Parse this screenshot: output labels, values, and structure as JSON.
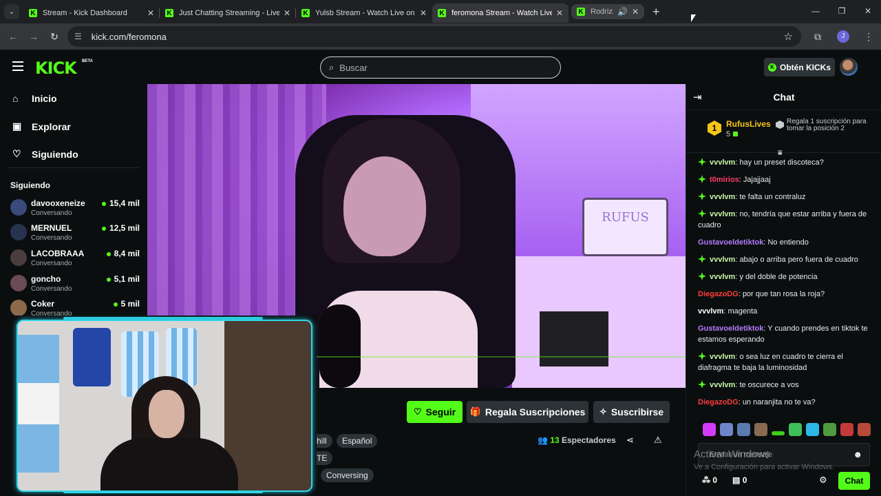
{
  "browser": {
    "tabs": [
      {
        "title": "Stream - Kick Dashboard"
      },
      {
        "title": "Just Chatting Streaming - Live S"
      },
      {
        "title": "Yulsb Stream - Watch Live on Ki"
      },
      {
        "title": "feromona Stream - Watch Live o"
      },
      {
        "title": "Rodrizz"
      }
    ],
    "url": "kick.com/feromona",
    "profile_initial": "J"
  },
  "header": {
    "logo": "KICK",
    "beta": "BETA",
    "search_placeholder": "Buscar",
    "get_kicks": "Obtén KICKs"
  },
  "sidebar": {
    "nav": [
      {
        "label": "Inicio",
        "icon": "home-icon"
      },
      {
        "label": "Explorar",
        "icon": "explore-icon"
      },
      {
        "label": "Siguiendo",
        "icon": "heart-icon"
      }
    ],
    "following_title": "Siguiendo",
    "following": [
      {
        "name": "davooxeneize",
        "category": "Conversando",
        "viewers": "15,4 mil"
      },
      {
        "name": "MERNUEL",
        "category": "Conversando",
        "viewers": "12,5 mil"
      },
      {
        "name": "LACOBRAAA",
        "category": "Conversando",
        "viewers": "8,4 mil"
      },
      {
        "name": "goncho",
        "category": "Conversando",
        "viewers": "5,1 mil"
      },
      {
        "name": "Coker",
        "category": "Conversando",
        "viewers": "5 mil"
      }
    ]
  },
  "stream": {
    "sign_text": "RUFUS",
    "follow_label": "Seguir",
    "gift_label": "Regala Suscripciones",
    "subscribe_label": "Suscribirse",
    "tags": [
      "hill",
      "Español",
      "TE",
      "Conversing"
    ],
    "viewers_count": "13",
    "viewers_label": "Espectadores"
  },
  "chat": {
    "title": "Chat",
    "pinned": {
      "rank": "1",
      "name": "RufusLives",
      "count": "5",
      "text": "Regala 1 suscripción para tomar la posición 2"
    },
    "messages": [
      {
        "user": "vvvlvm",
        "text": "hay un preset discoteca?",
        "badge": true,
        "color": "#c9f7a8"
      },
      {
        "user": "t0mirios",
        "text": "Jajajjaaj",
        "badge": true,
        "color": "#ff3b6b"
      },
      {
        "user": "vvvlvm",
        "text": "te falta un contraluz",
        "badge": true,
        "color": "#c9f7a8"
      },
      {
        "user": "vvvlvm",
        "text": "no, tendría que estar arriba y fuera de cuadro",
        "badge": true,
        "color": "#c9f7a8"
      },
      {
        "user": "Gustavoeldetiktok",
        "text": "No entiendo",
        "badge": false,
        "color": "#b37cff"
      },
      {
        "user": "vvvlvm",
        "text": "abajo o arriba pero fuera de cuadro",
        "badge": true,
        "color": "#c9f7a8"
      },
      {
        "user": "vvvlvm",
        "text": "y del doble de potencia",
        "badge": true,
        "color": "#c9f7a8"
      },
      {
        "user": "DiegazoDG",
        "text": "por que tan rosa la roja?",
        "badge": false,
        "color": "#ff3b3b"
      },
      {
        "user": "vvvlvm",
        "text": "magenta",
        "badge": false,
        "color": "#ffffff"
      },
      {
        "user": "Gustavoeldetiktok",
        "text": "Y cuando prendes en tiktok te estamos esperando",
        "badge": false,
        "color": "#b37cff"
      },
      {
        "user": "vvvlvm",
        "text": "o sea luz en cuadro te cierra el diafragma te baja la luminosidad",
        "badge": true,
        "color": "#c9f7a8"
      },
      {
        "user": "vvvlvm",
        "text": "te oscurece a vos",
        "badge": true,
        "color": "#c9f7a8"
      },
      {
        "user": "DiegazoDG",
        "text": "un naranjita no te va?",
        "badge": false,
        "color": "#ff3b3b"
      }
    ],
    "input_placeholder": "Enviar un mensaje",
    "points": "0",
    "shop": "0",
    "send_label": "Chat"
  },
  "os": {
    "activate_title": "Activar Windows",
    "activate_sub": "Ve a Configuración para activar Windows."
  },
  "colors": {
    "brand": "#53fc18",
    "bg": "#0b0e0f",
    "panel": "#2c3337"
  }
}
